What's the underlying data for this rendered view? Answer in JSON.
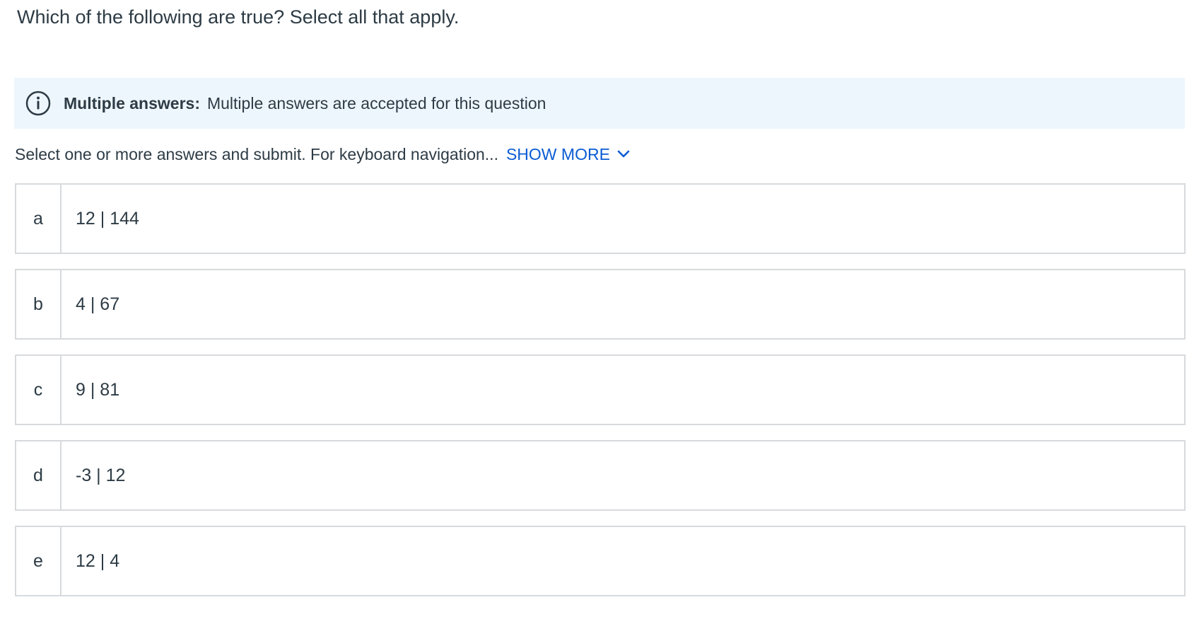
{
  "question": {
    "text": "Which of the following are true? Select all that apply."
  },
  "info_banner": {
    "icon": "info-icon",
    "title": "Multiple answers:",
    "message": "Multiple answers are accepted for this question"
  },
  "instructions": {
    "text": "Select one or more answers and submit. For keyboard navigation...",
    "show_more_label": "SHOW MORE",
    "show_more_icon": "chevron-down-icon"
  },
  "options": [
    {
      "letter": "a",
      "value": "12 | 144"
    },
    {
      "letter": "b",
      "value": "4 | 67"
    },
    {
      "letter": "c",
      "value": "9 | 81"
    },
    {
      "letter": "d",
      "value": "-3 | 12"
    },
    {
      "letter": "e",
      "value": "12 | 4"
    }
  ],
  "colors": {
    "text": "#2d3b45",
    "link": "#0b5bd3",
    "banner_bg": "#eef6fd",
    "border": "#d7dadd"
  }
}
